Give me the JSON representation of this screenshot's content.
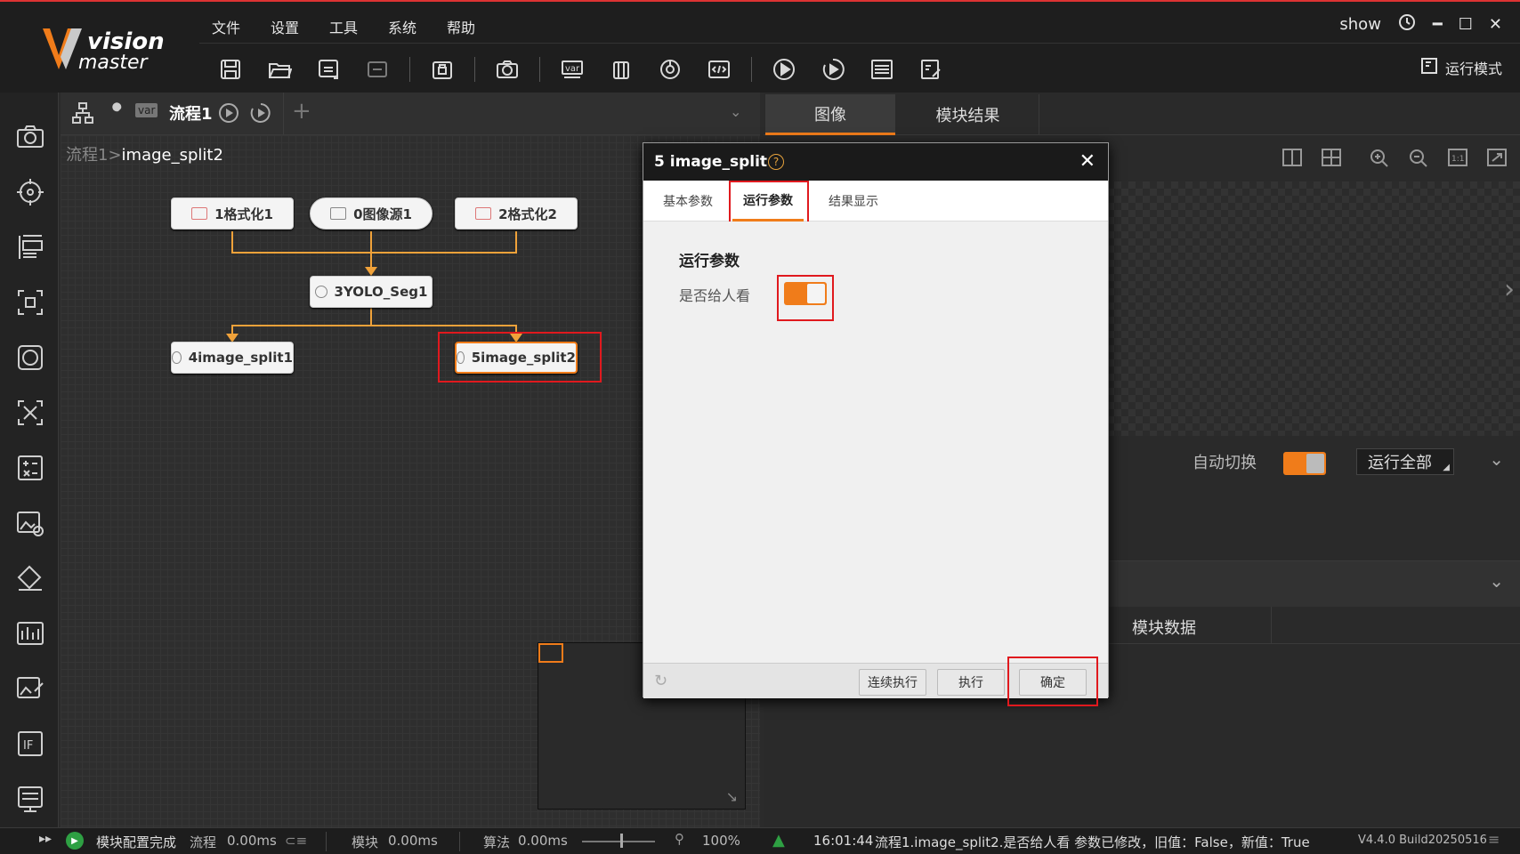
{
  "app": {
    "logo_main": "vision",
    "logo_sub": "master"
  },
  "menu": [
    "文件",
    "设置",
    "工具",
    "系统",
    "帮助"
  ],
  "window": {
    "show_label": "show",
    "run_mode_label": "运行模式"
  },
  "toolbar_icons": [
    "save-icon",
    "open-folder-icon",
    "save-as-icon",
    "import-icon",
    "lock-icon",
    "camera-icon",
    "var-icon",
    "device-icon",
    "global-script-icon",
    "code-icon",
    "run-once-icon",
    "run-loop-icon",
    "settings-list-icon",
    "export-doc-icon"
  ],
  "flow": {
    "tab_label": "流程1",
    "var_badge": "var",
    "breadcrumb_parent": "流程1",
    "breadcrumb_sep": ">",
    "breadcrumb_current": "image_split2",
    "nodes": {
      "fmt1": "1格式化1",
      "imgsrc": "0图像源1",
      "fmt2": "2格式化2",
      "yolo": "3YOLO_Seg1",
      "split1": "4image_split1",
      "split2": "5image_split2"
    }
  },
  "right_panel": {
    "tab_image": "图像",
    "tab_module_result": "模块结果",
    "auto_switch_label": "自动切换",
    "auto_switch_on": true,
    "run_all_label": "运行全部",
    "module_data_label": "模块数据"
  },
  "dialog": {
    "title": "5 image_split",
    "help_glyph": "?",
    "close_glyph": "✕",
    "tabs": [
      "基本参数",
      "运行参数",
      "结果显示"
    ],
    "active_tab": "运行参数",
    "section_title": "运行参数",
    "field_label": "是否给人看",
    "field_on": true,
    "btn_continuous": "连续执行",
    "btn_execute": "执行",
    "btn_confirm": "确定"
  },
  "status": {
    "config_done": "模块配置完成",
    "flow_label": "流程",
    "flow_time": "0.00ms",
    "module_label": "模块",
    "module_time": "0.00ms",
    "algo_label": "算法",
    "algo_time": "0.00ms",
    "zoom": "100%",
    "log_time": "16:01:44",
    "log_message": "流程1.image_split2.是否给人看 参数已修改，旧值：False，新值：True",
    "version": "V4.4.0 Build20250516"
  },
  "colors": {
    "accent": "#f07c1a",
    "highlight_box": "#e0191e",
    "connector": "#f0a23a"
  }
}
